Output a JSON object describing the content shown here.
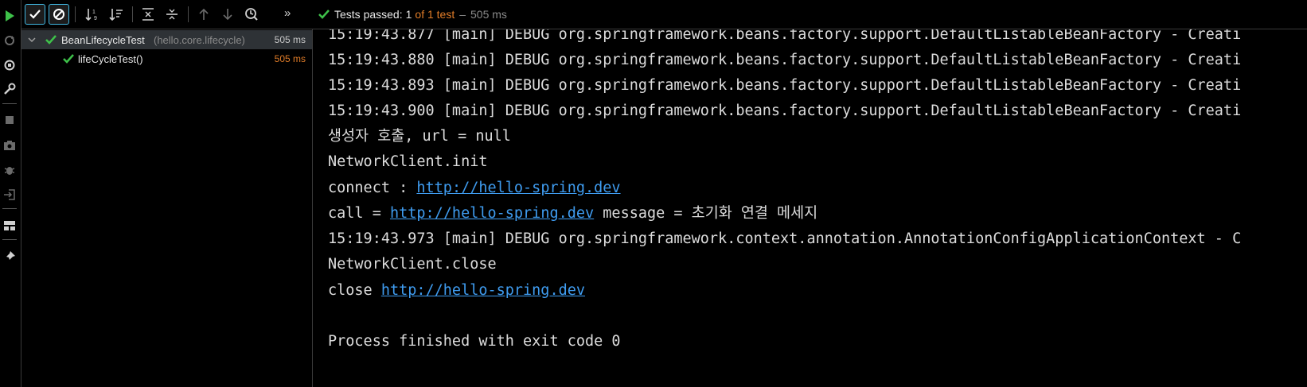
{
  "toolbar": {
    "buttons": [
      {
        "name": "rerun-icon",
        "label": "Rerun"
      },
      {
        "name": "show-passed-icon",
        "label": "Show Passed"
      },
      {
        "name": "show-ignored-icon",
        "label": "Show Ignored"
      },
      {
        "name": "sort-alphabetically-icon",
        "label": "Sort Alphabetically"
      },
      {
        "name": "sort-by-duration-icon",
        "label": "Sort by Duration"
      },
      {
        "name": "expand-all-icon",
        "label": "Expand All"
      },
      {
        "name": "collapse-all-icon",
        "label": "Collapse All"
      },
      {
        "name": "previous-failed-icon",
        "label": "Previous Failed Test"
      },
      {
        "name": "next-failed-icon",
        "label": "Next Failed Test"
      },
      {
        "name": "test-history-icon",
        "label": "Test History"
      }
    ],
    "more": "»"
  },
  "status": {
    "prefix": "Tests passed:",
    "passed": "1",
    "of_total": "of 1 test",
    "dash": "–",
    "duration": "505 ms",
    "colors": {
      "check": "#3ec14a",
      "count": "#e07c28",
      "muted": "#8a8a8a"
    }
  },
  "tree": {
    "suite": {
      "name": "BeanLifecycleTest",
      "package": "(hello.core.lifecycle)",
      "duration": "505 ms"
    },
    "tests": [
      {
        "name": "lifeCycleTest()",
        "duration": "505 ms"
      }
    ]
  },
  "console": {
    "lines": [
      {
        "text": "15:19:43.877 [main] DEBUG org.springframework.beans.factory.support.DefaultListableBeanFactory - Creati"
      },
      {
        "text": "15:19:43.880 [main] DEBUG org.springframework.beans.factory.support.DefaultListableBeanFactory - Creati"
      },
      {
        "text": "15:19:43.893 [main] DEBUG org.springframework.beans.factory.support.DefaultListableBeanFactory - Creati"
      },
      {
        "text": "15:19:43.900 [main] DEBUG org.springframework.beans.factory.support.DefaultListableBeanFactory - Creati"
      },
      {
        "text": "생성자 호출, url = null"
      },
      {
        "text": "NetworkClient.init"
      },
      {
        "pre": "connect : ",
        "link": "http://hello-spring.dev"
      },
      {
        "pre": "call = ",
        "link": "http://hello-spring.dev",
        "post": " message = 초기화 연결 메세지"
      },
      {
        "text": "15:19:43.973 [main] DEBUG org.springframework.context.annotation.AnnotationConfigApplicationContext - C"
      },
      {
        "text": "NetworkClient.close"
      },
      {
        "pre": "close ",
        "link": "http://hello-spring.dev"
      },
      {
        "text": ""
      },
      {
        "text": "Process finished with exit code 0"
      }
    ]
  },
  "sidebar": {
    "icons": [
      "run-icon",
      "rerun-failed-icon",
      "toggle-auto-test-icon",
      "settings-wrench-icon",
      "stop-icon",
      "screenshot-camera-icon",
      "debug-bug-icon",
      "import-tests-icon",
      "layout-icon",
      "pin-icon"
    ]
  }
}
